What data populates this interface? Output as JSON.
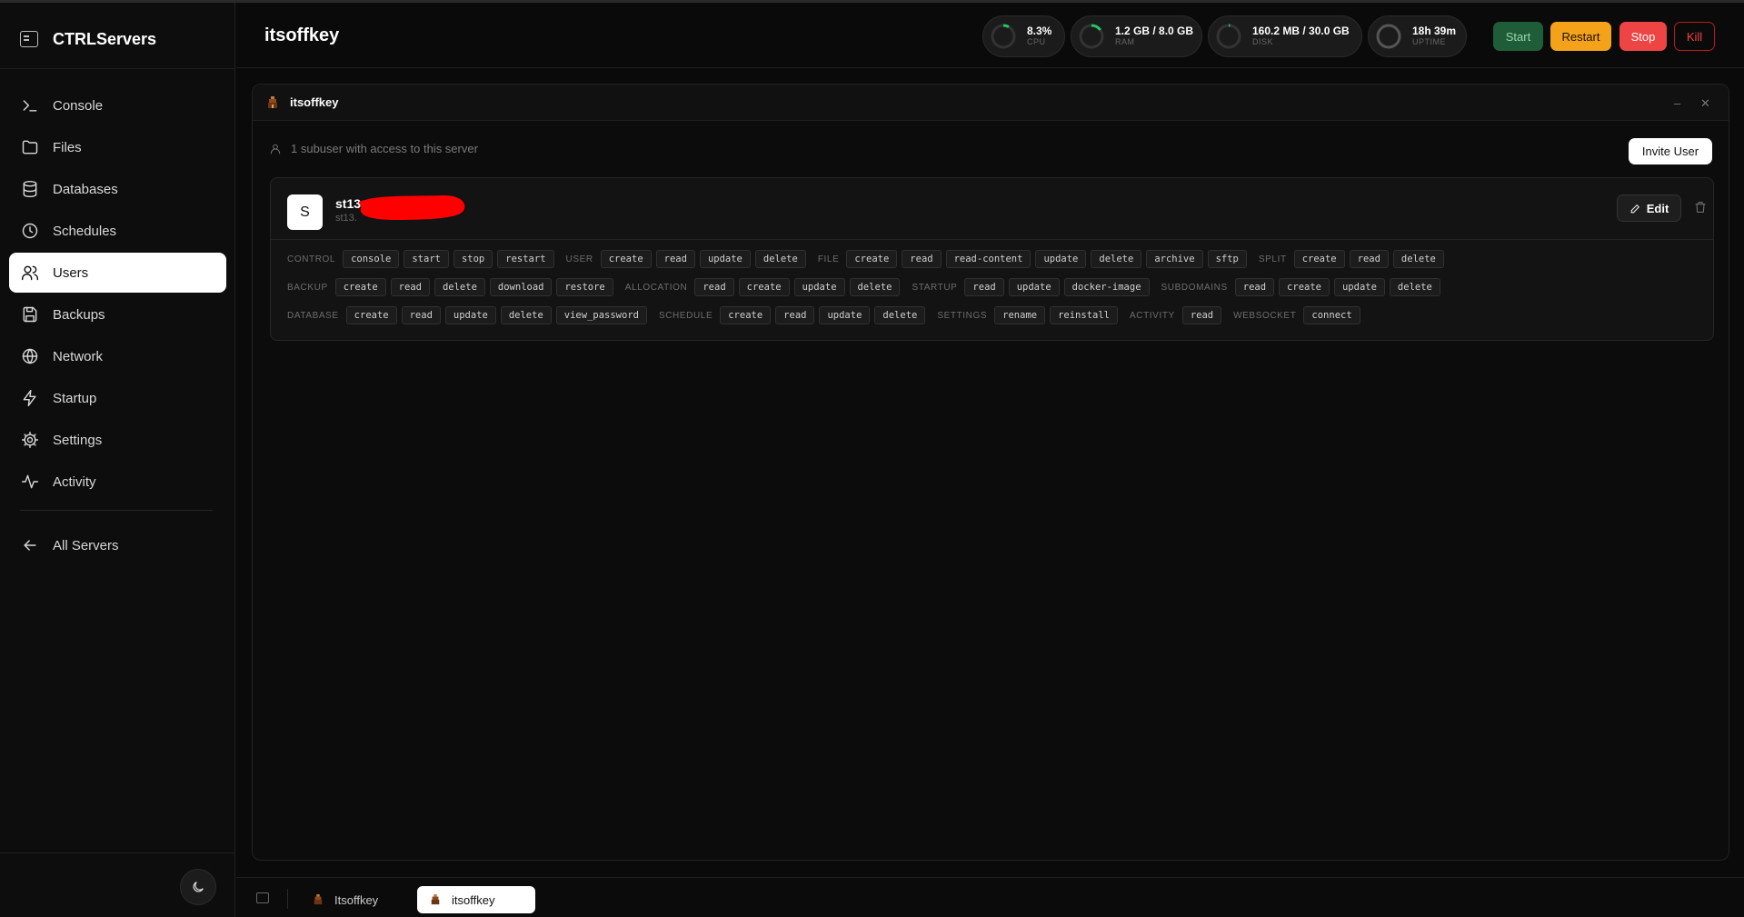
{
  "brand": {
    "name": "CTRLServers"
  },
  "sidebar": {
    "items": [
      {
        "label": "Console",
        "icon": "terminal-icon"
      },
      {
        "label": "Files",
        "icon": "folder-icon"
      },
      {
        "label": "Databases",
        "icon": "database-icon"
      },
      {
        "label": "Schedules",
        "icon": "clock-icon"
      },
      {
        "label": "Users",
        "icon": "users-icon",
        "active": true
      },
      {
        "label": "Backups",
        "icon": "save-icon"
      },
      {
        "label": "Network",
        "icon": "globe-icon"
      },
      {
        "label": "Startup",
        "icon": "bolt-icon"
      },
      {
        "label": "Settings",
        "icon": "gear-icon"
      },
      {
        "label": "Activity",
        "icon": "activity-icon"
      }
    ],
    "all_servers": "All Servers"
  },
  "header": {
    "title": "itsoffkey",
    "stats": {
      "cpu": {
        "value": "8.3%",
        "label": "CPU",
        "fraction": 0.083
      },
      "ram": {
        "value": "1.2 GB / 8.0 GB",
        "label": "RAM",
        "fraction": 0.15
      },
      "disk": {
        "value": "160.2 MB / 30.0 GB",
        "label": "DISK",
        "fraction": 0.005
      },
      "uptime": {
        "value": "18h 39m",
        "label": "UPTIME"
      }
    },
    "controls": {
      "start": "Start",
      "restart": "Restart",
      "stop": "Stop",
      "kill": "Kill"
    }
  },
  "panel": {
    "title": "itsoffkey",
    "subusers_text": "1 subuser with access to this server",
    "invite_label": "Invite User",
    "user": {
      "initial": "S",
      "name": "st13.",
      "sub": "st13.",
      "edit_label": "Edit",
      "permission_rows": [
        [
          {
            "group": "CONTROL",
            "perms": [
              "console",
              "start",
              "stop",
              "restart"
            ]
          },
          {
            "group": "USER",
            "perms": [
              "create",
              "read",
              "update",
              "delete"
            ]
          },
          {
            "group": "FILE",
            "perms": [
              "create",
              "read",
              "read-content",
              "update",
              "delete",
              "archive",
              "sftp"
            ]
          },
          {
            "group": "SPLIT",
            "perms": [
              "create",
              "read",
              "delete"
            ]
          }
        ],
        [
          {
            "group": "BACKUP",
            "perms": [
              "create",
              "read",
              "delete",
              "download",
              "restore"
            ]
          },
          {
            "group": "ALLOCATION",
            "perms": [
              "read",
              "create",
              "update",
              "delete"
            ]
          },
          {
            "group": "STARTUP",
            "perms": [
              "read",
              "update",
              "docker-image"
            ]
          },
          {
            "group": "SUBDOMAINS",
            "perms": [
              "read",
              "create",
              "update",
              "delete"
            ]
          }
        ],
        [
          {
            "group": "DATABASE",
            "perms": [
              "create",
              "read",
              "update",
              "delete",
              "view_password"
            ]
          },
          {
            "group": "SCHEDULE",
            "perms": [
              "create",
              "read",
              "update",
              "delete"
            ]
          },
          {
            "group": "SETTINGS",
            "perms": [
              "rename",
              "reinstall"
            ]
          },
          {
            "group": "ACTIVITY",
            "perms": [
              "read"
            ]
          },
          {
            "group": "WEBSOCKET",
            "perms": [
              "connect"
            ]
          }
        ]
      ]
    }
  },
  "bottom_tabs": [
    {
      "label": "Itsoffkey",
      "active": false
    },
    {
      "label": "itsoffkey",
      "active": true
    }
  ],
  "colors": {
    "start_bg": "#1f5c38",
    "start_fg": "#9ad7ad",
    "restart_bg": "#f5a21b",
    "restart_fg": "#1a1000",
    "stop_bg": "#ef4444",
    "stop_fg": "#ffffff",
    "kill_border": "#b91c1c",
    "kill_fg": "#ef4444",
    "ring_green": "#22c55e",
    "redaction": "#ff0000"
  }
}
